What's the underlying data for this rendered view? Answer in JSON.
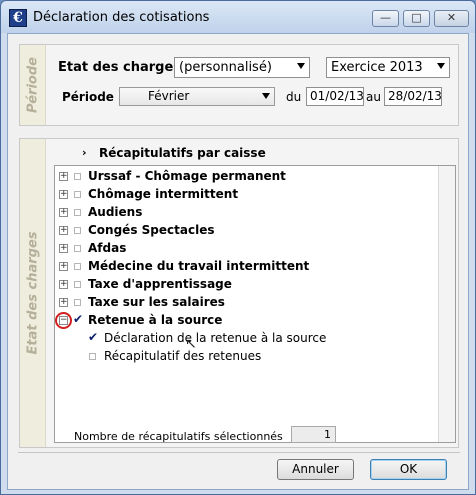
{
  "window": {
    "title": "Déclaration des cotisations",
    "app_icon_glyph": "€",
    "min_glyph": "—",
    "max_glyph": "□",
    "close_glyph": "✕"
  },
  "periode_group": {
    "side_label": "Période",
    "etat_label": "Etat des charges",
    "etat_value": "(personnalisé)",
    "exercice_value": "Exercice 2013",
    "periode_label": "Période",
    "periode_value": "Février",
    "du_label": "du",
    "du_value": "01/02/13",
    "au_label": "au",
    "au_value": "28/02/13"
  },
  "etat_group": {
    "side_label": "Etat des charges",
    "header_chevron": "›",
    "header_label": "Récapitulatifs par caisse",
    "nodes": [
      {
        "label": "Urssaf - Chômage permanent",
        "expander": "+",
        "checked": false
      },
      {
        "label": "Chômage intermittent",
        "expander": "+",
        "checked": false
      },
      {
        "label": "Audiens",
        "expander": "+",
        "checked": false
      },
      {
        "label": "Congés Spectacles",
        "expander": "+",
        "checked": false
      },
      {
        "label": "Afdas",
        "expander": "+",
        "checked": false
      },
      {
        "label": "Médecine du travail intermittent",
        "expander": "+",
        "checked": false
      },
      {
        "label": "Taxe d'apprentissage",
        "expander": "+",
        "checked": false
      },
      {
        "label": "Taxe sur les salaires",
        "expander": "+",
        "checked": false
      },
      {
        "label": "Retenue à la source",
        "expander": "−",
        "checked": true
      }
    ],
    "children": [
      {
        "label": "Déclaration de la retenue à la source",
        "checked": true
      },
      {
        "label": "Récapitulatif des retenues",
        "checked": false
      }
    ],
    "check_glyph": "✔",
    "cursor_glyph": "↖"
  },
  "footer": {
    "count_label": "Nombre de récapitulatifs sélectionnés",
    "count_value": "1",
    "cancel_label": "Annuler",
    "ok_label": "OK"
  },
  "colors": {
    "highlight_ring": "#d02020",
    "check": "#0d1f6e"
  }
}
